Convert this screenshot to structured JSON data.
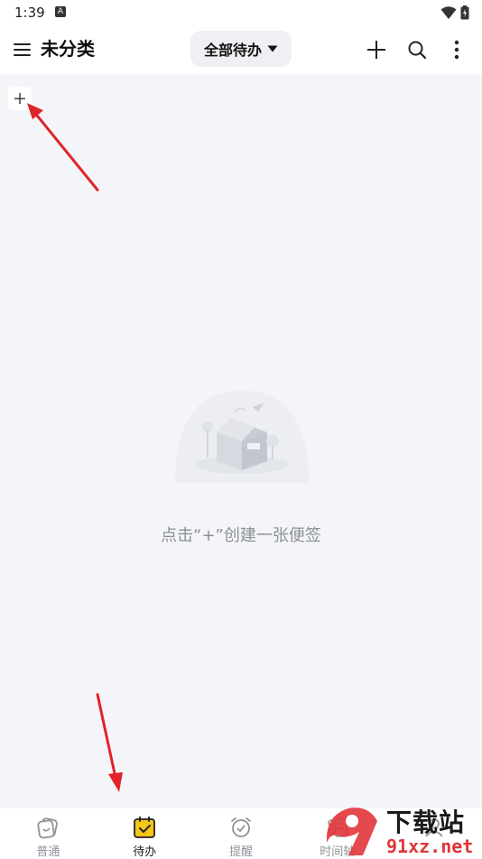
{
  "status_bar": {
    "time": "1:39",
    "notification": "A"
  },
  "header": {
    "title": "未分类",
    "filter_label": "全部待办",
    "menu_icon": "hamburger-menu-icon",
    "add_icon": "plus-icon",
    "search_icon": "search-icon",
    "more_icon": "more-vertical-icon"
  },
  "main": {
    "add_small_icon": "plus-icon",
    "empty_text": "点击“+”创建一张便签"
  },
  "tabs": [
    {
      "label": "普通",
      "icon": "note-icon",
      "active": false
    },
    {
      "label": "待办",
      "icon": "todo-calendar-icon",
      "active": true
    },
    {
      "label": "提醒",
      "icon": "alarm-clock-icon",
      "active": false
    },
    {
      "label": "时间轴",
      "icon": "timeline-icon",
      "active": false
    },
    {
      "label": "",
      "icon": "person-icon",
      "active": false
    }
  ],
  "watermark": {
    "text1": "下载站",
    "text2": "91xz.net"
  },
  "colors": {
    "accent": "#f5c518",
    "arrow": "#e0242a",
    "background": "#f4f5f8"
  }
}
